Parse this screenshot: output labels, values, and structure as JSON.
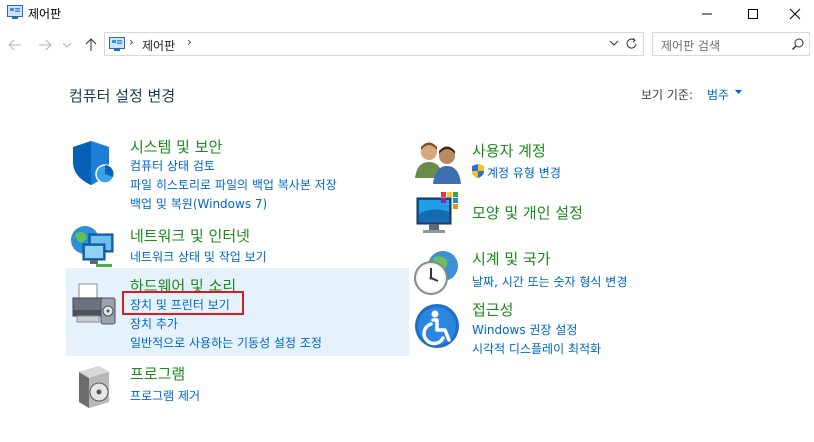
{
  "window": {
    "title": "제어판"
  },
  "address": {
    "path": "제어판",
    "separator": "›"
  },
  "search": {
    "placeholder": "제어판 검색"
  },
  "header": {
    "title": "컴퓨터 설정 변경",
    "view_by_label": "보기 기준:",
    "view_by_value": "범주"
  },
  "categories": {
    "system": {
      "title": "시스템 및 보안",
      "links": [
        "컴퓨터 상태 검토",
        "파일 히스토리로 파일의 백업 복사본 저장",
        "백업 및 복원(Windows 7)"
      ]
    },
    "network": {
      "title": "네트워크 및 인터넷",
      "links": [
        "네트워크 상태 및 작업 보기"
      ]
    },
    "hardware": {
      "title": "하드웨어 및 소리",
      "links": [
        "장치 및 프린터 보기",
        "장치 추가",
        "일반적으로 사용하는 기동성 설정 조정"
      ]
    },
    "programs": {
      "title": "프로그램",
      "links": [
        "프로그램 제거"
      ]
    },
    "users": {
      "title": "사용자 계정",
      "links": [
        "계정 유형 변경"
      ]
    },
    "appearance": {
      "title": "모양 및 개인 설정",
      "links": []
    },
    "clock": {
      "title": "시계 및 국가",
      "links": [
        "날짜, 시간 또는 숫자 형식 변경"
      ]
    },
    "ease": {
      "title": "접근성",
      "links": [
        "Windows 권장 설정",
        "시각적 디스플레이 최적화"
      ]
    }
  },
  "colors": {
    "category_title": "#1c8a1c",
    "link": "#0066cc",
    "highlight": "#e5f1fb",
    "annotation": "#d71d1d"
  }
}
